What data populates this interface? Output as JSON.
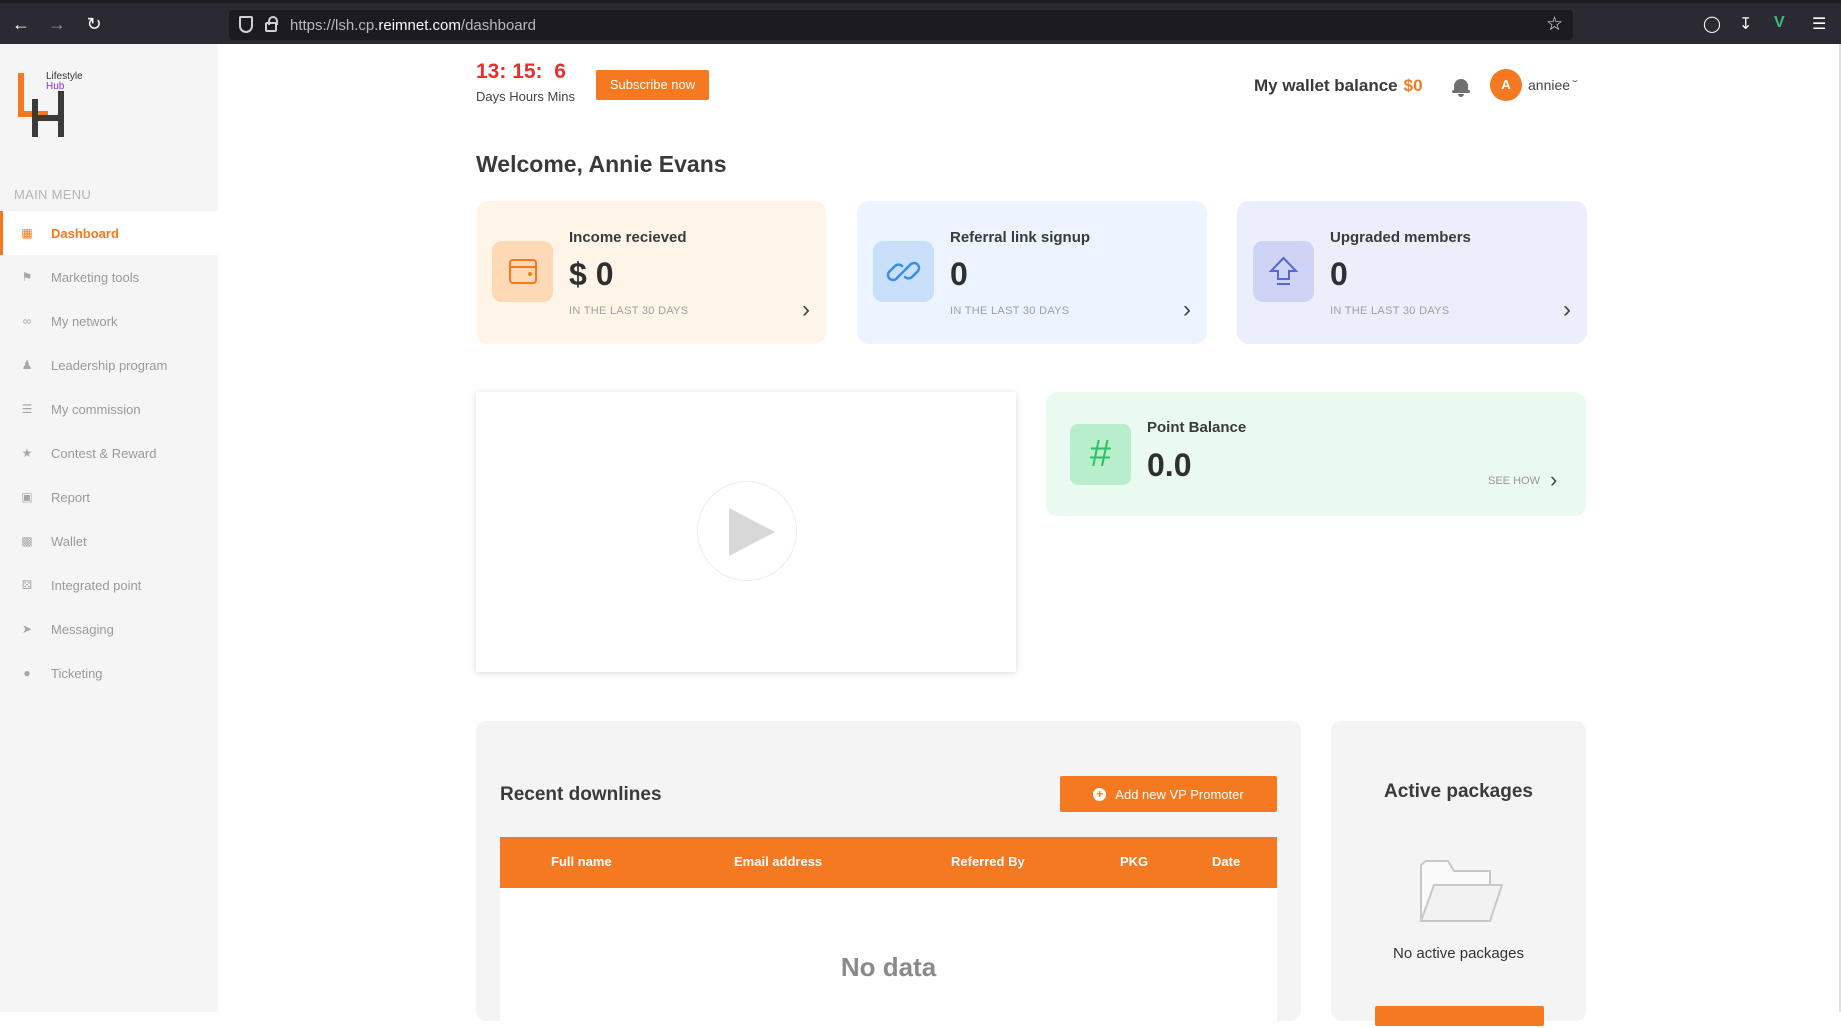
{
  "browser": {
    "url_prefix": "https://lsh.cp.",
    "url_domain": "reimnet.com",
    "url_path": "/dashboard"
  },
  "sidebar": {
    "logo_line1": "Lifestyle",
    "logo_line2": "Hub",
    "menu_title": "MAIN MENU",
    "items": [
      {
        "label": "Dashboard",
        "icon": "grid-icon"
      },
      {
        "label": "Marketing tools",
        "icon": "megaphone-icon"
      },
      {
        "label": "My network",
        "icon": "network-icon"
      },
      {
        "label": "Leadership program",
        "icon": "users-icon"
      },
      {
        "label": "My commission",
        "icon": "layers-icon"
      },
      {
        "label": "Contest & Reward",
        "icon": "trophy-icon"
      },
      {
        "label": "Report",
        "icon": "chat-icon"
      },
      {
        "label": "Wallet",
        "icon": "wallet-icon"
      },
      {
        "label": "Integrated point",
        "icon": "dice-icon"
      },
      {
        "label": "Messaging",
        "icon": "send-icon"
      },
      {
        "label": "Ticketing",
        "icon": "headset-icon"
      }
    ]
  },
  "header": {
    "timer_days": "13:",
    "timer_hours": "15:",
    "timer_mins": "6",
    "timer_units": "Days Hours Mins",
    "subscribe_label": "Subscribe now",
    "wallet_label": "My wallet balance",
    "wallet_amount": "$0",
    "avatar_letter": "A",
    "username": "anniee"
  },
  "welcome": "Welcome, Annie Evans",
  "stats": [
    {
      "title": "Income recieved",
      "value": "$ 0",
      "footnote": "IN THE LAST 30 DAYS",
      "bg": "#fff4e8",
      "icon_bg": "#fdd9b5"
    },
    {
      "title": "Referral link signup",
      "value": "0",
      "footnote": "IN THE LAST 30 DAYS",
      "bg": "#ebf4ff",
      "icon_bg": "#c9e0fb"
    },
    {
      "title": "Upgraded members",
      "value": "0",
      "footnote": "IN THE LAST 30 DAYS",
      "bg": "#eceefc",
      "icon_bg": "#cfd3f6"
    }
  ],
  "points": {
    "title": "Point Balance",
    "value": "0.0",
    "see_how": "SEE HOW"
  },
  "downlines": {
    "title": "Recent downlines",
    "add_label": "Add new VP Promoter",
    "columns": [
      "Full name",
      "Email address",
      "Referred By",
      "PKG",
      "Date"
    ],
    "empty": "No data"
  },
  "packages": {
    "title": "Active packages",
    "empty": "No active packages"
  },
  "colors": {
    "accent": "#f47920",
    "timer": "#e8302b"
  }
}
